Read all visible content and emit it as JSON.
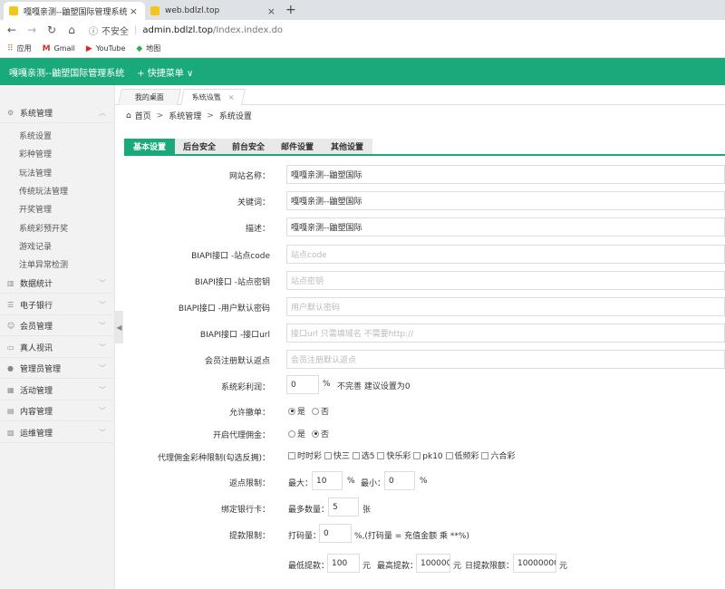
{
  "browser": {
    "tabs": [
      {
        "title": "嘎嘎亲测--鼬塑国际管理系统",
        "active": true
      },
      {
        "title": "web.bdlzl.top",
        "active": false
      }
    ],
    "close_glyph": "×",
    "new_tab_glyph": "+",
    "address": {
      "security": "不安全",
      "host": "admin.bdlzl.top",
      "path": "/Index.index.do"
    },
    "bookmarks": [
      {
        "label": "应用",
        "icon": "apps-grid-icon"
      },
      {
        "label": "Gmail",
        "icon": "gmail-icon"
      },
      {
        "label": "YouTube",
        "icon": "youtube-icon"
      },
      {
        "label": "地图",
        "icon": "maps-icon"
      }
    ]
  },
  "header": {
    "title": "嘎嘎亲测--鼬塑国际管理系统",
    "quick_menu": "+ 快捷菜单 ∨",
    "color": "#1aa97b"
  },
  "sidebar": {
    "groups": [
      {
        "label": "系统管理",
        "icon": "gear-icon"
      },
      {
        "label": "数据统计",
        "icon": "bar-chart-icon"
      },
      {
        "label": "电子银行",
        "icon": "list-icon"
      },
      {
        "label": "会员管理",
        "icon": "user-icon"
      },
      {
        "label": "真人视讯",
        "icon": "monitor-icon"
      },
      {
        "label": "管理员管理",
        "icon": "admin-user-icon"
      },
      {
        "label": "活动管理",
        "icon": "calendar-icon"
      },
      {
        "label": "内容管理",
        "icon": "content-icon"
      },
      {
        "label": "运维管理",
        "icon": "ops-icon"
      }
    ],
    "sub_items": [
      "系统设置",
      "彩种管理",
      "玩法管理",
      "传统玩法管理",
      "开奖管理",
      "系统彩预开奖",
      "游戏记录",
      "注单异常检测"
    ]
  },
  "content_tabs": [
    {
      "label": "我的桌面"
    },
    {
      "label": "系统设置",
      "close": "×"
    }
  ],
  "breadcrumb": {
    "items": [
      "首页",
      "系统管理",
      "系统设置"
    ],
    "separator": ">"
  },
  "settings_tabs": [
    "基本设置",
    "后台安全",
    "前台安全",
    "邮件设置",
    "其他设置"
  ],
  "form": {
    "site_name": {
      "label": "网站名称：",
      "value": "嘎嘎亲测--鼬塑国际"
    },
    "keywords": {
      "label": "关键词：",
      "value": "嘎嘎亲测--鼬塑国际"
    },
    "description": {
      "label": "描述：",
      "value": "嘎嘎亲测--鼬塑国际"
    },
    "biapi_code": {
      "label": "BIAPI接口 -站点code",
      "placeholder": "站点code"
    },
    "biapi_key": {
      "label": "BIAPI接口 -站点密钥",
      "placeholder": "站点密钥"
    },
    "biapi_pwd": {
      "label": "BIAPI接口 -用户默认密码",
      "placeholder": "用户默认密码"
    },
    "biapi_url": {
      "label": "BIAPI接口 -接口url",
      "placeholder": "接口url 只需填域名 不需要http://"
    },
    "reg_rebate": {
      "label": "会员注册默认返点",
      "placeholder": "会员注册默认返点"
    },
    "profit": {
      "label": "系统彩利润：",
      "value": "0",
      "unit": "%",
      "note": "不完善 建议设置为0"
    },
    "allow_cancel": {
      "label": "允许撤单：",
      "yes": "是",
      "no": "否",
      "selected": "是"
    },
    "agent_commission": {
      "label": "开启代理佣金：",
      "yes": "是",
      "no": "否",
      "selected": "否"
    },
    "agent_limit": {
      "label": "代理佣金彩种限制(勾选反拥)：",
      "options": [
        "时时彩",
        "快三",
        "选5",
        "快乐彩",
        "pk10",
        "低频彩",
        "六合彩"
      ]
    },
    "rebate_limit": {
      "label": "返点限制：",
      "max_label": "最大：",
      "max_value": "10",
      "min_label": "最小：",
      "min_value": "0",
      "unit": "%"
    },
    "bind_card": {
      "label": "绑定银行卡：",
      "max_label": "最多数量：",
      "value": "5",
      "unit": "张"
    },
    "withdraw": {
      "label": "提款限制：",
      "code_label": "打码量：",
      "code_value": "0",
      "code_note": "%,(打码量 = 充值金额 乘 **%)"
    },
    "withdraw_amounts": {
      "min_label": "最低提款：",
      "min_value": "100",
      "max_label": "最高提款：",
      "max_value": "100000",
      "daily_label": "日提款限额：",
      "daily_value": "10000000",
      "unit": "元"
    }
  }
}
